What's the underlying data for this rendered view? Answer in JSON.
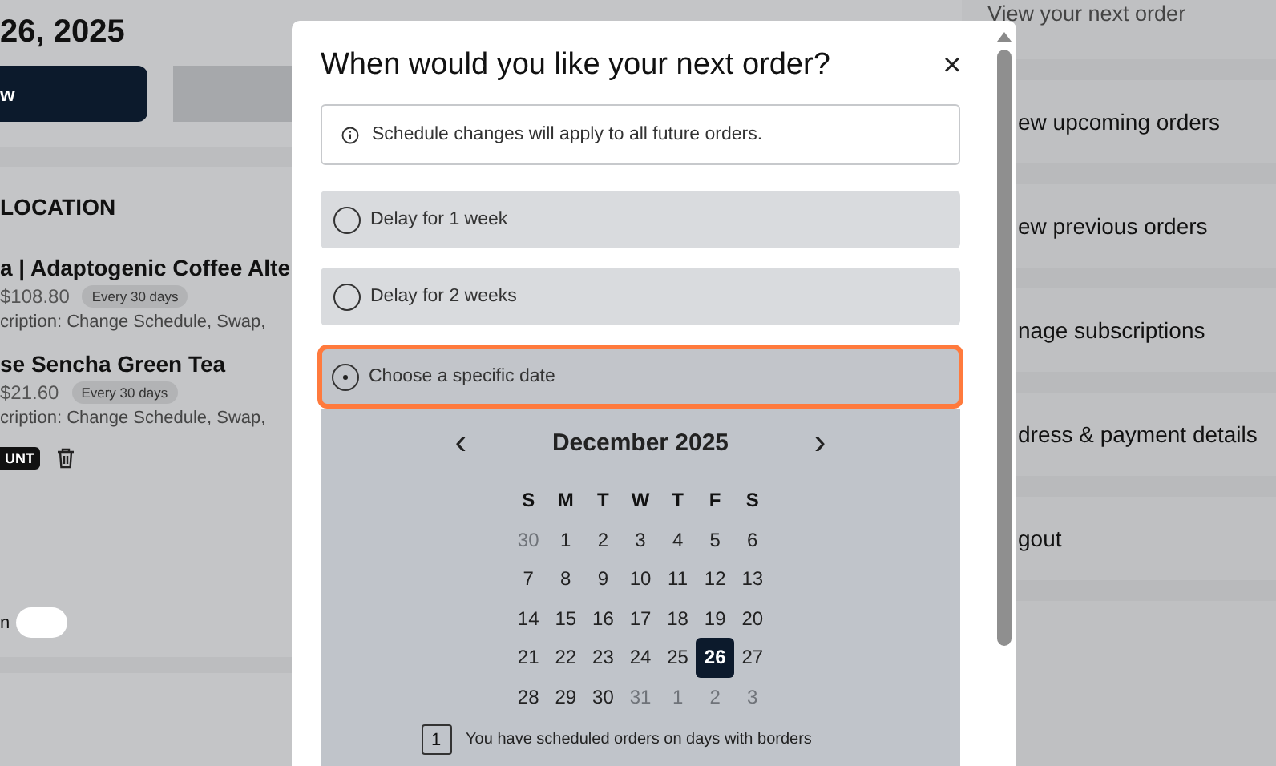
{
  "page": {
    "date_heading": "26, 2025",
    "primary_button": "w",
    "section_title": "LOCATION",
    "products": [
      {
        "name": "a | Adaptogenic Coffee Alte",
        "price": "$108.80",
        "frequency": "Every 30 days",
        "description": "cription: Change Schedule, Swap,"
      },
      {
        "name": "se Sencha Green Tea",
        "price": "$21.60",
        "frequency": "Every 30 days",
        "description": "cription: Change Schedule, Swap,"
      }
    ],
    "discount_badge": "UNT",
    "footer_label": "n"
  },
  "sidebar": {
    "items": [
      {
        "label": "View your next order"
      },
      {
        "label": "ew upcoming orders"
      },
      {
        "label": "ew previous orders"
      },
      {
        "label": "nage subscriptions"
      },
      {
        "label": "dress & payment details"
      },
      {
        "label": "gout"
      }
    ]
  },
  "dialog": {
    "title": "When would you like your next order?",
    "close": "×",
    "notice": "Schedule changes will apply to all future orders.",
    "options": [
      {
        "label": "Delay for 1 week",
        "selected": false
      },
      {
        "label": "Delay for 2 weeks",
        "selected": false
      },
      {
        "label": "Choose a specific date",
        "selected": true
      }
    ],
    "calendar": {
      "prev": "‹",
      "month": "December 2025",
      "next": "›",
      "weekdays": [
        "S",
        "M",
        "T",
        "W",
        "T",
        "F",
        "S"
      ],
      "weeks": [
        [
          {
            "day": "30",
            "muted": true,
            "selected": false
          },
          {
            "day": "1",
            "muted": false,
            "selected": false
          },
          {
            "day": "2",
            "muted": false,
            "selected": false
          },
          {
            "day": "3",
            "muted": false,
            "selected": false
          },
          {
            "day": "4",
            "muted": false,
            "selected": false
          },
          {
            "day": "5",
            "muted": false,
            "selected": false
          },
          {
            "day": "6",
            "muted": false,
            "selected": false
          }
        ],
        [
          {
            "day": "7",
            "muted": false,
            "selected": false
          },
          {
            "day": "8",
            "muted": false,
            "selected": false
          },
          {
            "day": "9",
            "muted": false,
            "selected": false
          },
          {
            "day": "10",
            "muted": false,
            "selected": false
          },
          {
            "day": "11",
            "muted": false,
            "selected": false
          },
          {
            "day": "12",
            "muted": false,
            "selected": false
          },
          {
            "day": "13",
            "muted": false,
            "selected": false
          }
        ],
        [
          {
            "day": "14",
            "muted": false,
            "selected": false
          },
          {
            "day": "15",
            "muted": false,
            "selected": false
          },
          {
            "day": "16",
            "muted": false,
            "selected": false
          },
          {
            "day": "17",
            "muted": false,
            "selected": false
          },
          {
            "day": "18",
            "muted": false,
            "selected": false
          },
          {
            "day": "19",
            "muted": false,
            "selected": false
          },
          {
            "day": "20",
            "muted": false,
            "selected": false
          }
        ],
        [
          {
            "day": "21",
            "muted": false,
            "selected": false
          },
          {
            "day": "22",
            "muted": false,
            "selected": false
          },
          {
            "day": "23",
            "muted": false,
            "selected": false
          },
          {
            "day": "24",
            "muted": false,
            "selected": false
          },
          {
            "day": "25",
            "muted": false,
            "selected": false
          },
          {
            "day": "26",
            "muted": false,
            "selected": true
          },
          {
            "day": "27",
            "muted": false,
            "selected": false
          }
        ],
        [
          {
            "day": "28",
            "muted": false,
            "selected": false
          },
          {
            "day": "29",
            "muted": false,
            "selected": false
          },
          {
            "day": "30",
            "muted": false,
            "selected": false
          },
          {
            "day": "31",
            "muted": true,
            "selected": false
          },
          {
            "day": "1",
            "muted": true,
            "selected": false
          },
          {
            "day": "2",
            "muted": true,
            "selected": false
          },
          {
            "day": "3",
            "muted": true,
            "selected": false
          }
        ]
      ],
      "legend_sample": "1",
      "legend": "You have scheduled orders on days with borders"
    }
  }
}
